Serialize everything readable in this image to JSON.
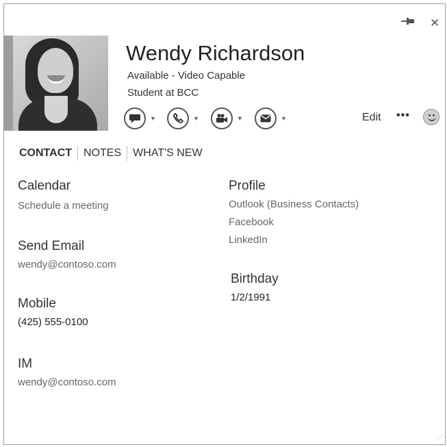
{
  "window": {
    "pin_icon": "pin-icon",
    "close_glyph": "✕"
  },
  "contact": {
    "name": "Wendy Richardson",
    "status": "Available - Video Capable",
    "title": "Student at BCC"
  },
  "actions": [
    {
      "name": "im",
      "icon": "chat-bubble-icon"
    },
    {
      "name": "call",
      "icon": "phone-icon"
    },
    {
      "name": "video",
      "icon": "video-camera-icon"
    },
    {
      "name": "email",
      "icon": "envelope-icon"
    }
  ],
  "toolbar": {
    "edit_label": "Edit",
    "more_label": "•••"
  },
  "tabs": [
    {
      "label": "CONTACT",
      "active": true
    },
    {
      "label": "NOTES",
      "active": false
    },
    {
      "label": "WHAT'S NEW",
      "active": false
    }
  ],
  "details": {
    "calendar": {
      "label": "Calendar",
      "value": "Schedule a meeting"
    },
    "send_email": {
      "label": "Send Email",
      "value": "wendy@contoso.com"
    },
    "mobile": {
      "label": "Mobile",
      "value": "(425) 555-0100"
    },
    "im": {
      "label": "IM",
      "value": "wendy@contoso.com"
    },
    "profile": {
      "label": "Profile",
      "links": [
        "Outlook (Business Contacts)",
        "Facebook",
        "LinkedIn"
      ]
    },
    "birthday": {
      "label": "Birthday",
      "value": "1/2/1991"
    }
  },
  "colors": {
    "accent": "#9c9c9c",
    "border": "#9a9a9a"
  }
}
